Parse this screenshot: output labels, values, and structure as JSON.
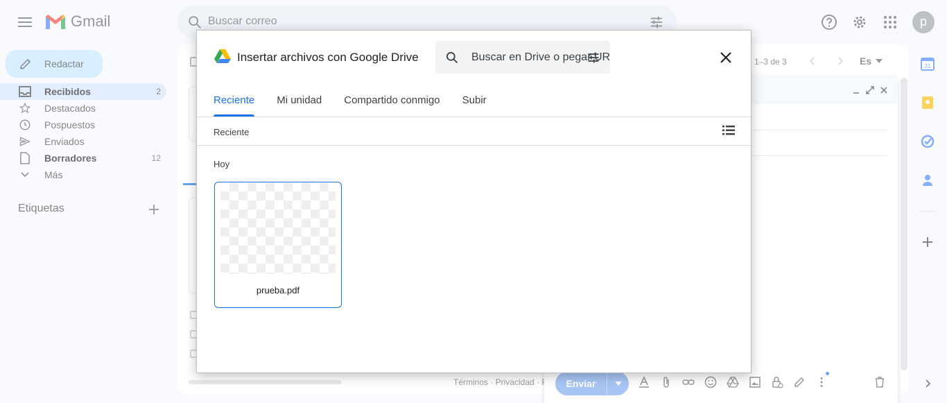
{
  "app": {
    "name": "Gmail"
  },
  "search": {
    "placeholder": "Buscar correo"
  },
  "avatar": {
    "initial": "p"
  },
  "sidebar": {
    "compose_label": "Redactar",
    "items": [
      {
        "label": "Recibidos",
        "count": "2",
        "icon": "inbox-icon",
        "active": true,
        "bold": true
      },
      {
        "label": "Destacados",
        "count": "",
        "icon": "star-icon"
      },
      {
        "label": "Pospuestos",
        "count": "",
        "icon": "clock-icon"
      },
      {
        "label": "Enviados",
        "count": "",
        "icon": "send-icon"
      },
      {
        "label": "Borradores",
        "count": "12",
        "icon": "draft-icon",
        "bold": true
      },
      {
        "label": "Más",
        "count": "",
        "icon": "chevron-down-icon"
      }
    ],
    "labels_title": "Etiquetas"
  },
  "main": {
    "pager": "1–3 de 3",
    "lang": "Es",
    "footer": "Términos · Privacidad · P"
  },
  "compose_window": {
    "send_label": "Enviar"
  },
  "dialog": {
    "title": "Insertar archivos con Google Drive",
    "search_placeholder": "Buscar en Drive o pegar URL",
    "tabs": [
      "Reciente",
      "Mi unidad",
      "Compartido conmigo",
      "Subir"
    ],
    "active_tab": "Reciente",
    "breadcrumb": "Reciente",
    "section": "Hoy",
    "files": [
      {
        "name": "prueba.pdf"
      }
    ]
  },
  "colors": {
    "accent": "#1a73e8",
    "compose_bg": "#c2e7ff",
    "active_nav": "#d3e3fd",
    "send": "#7aa7ee"
  }
}
